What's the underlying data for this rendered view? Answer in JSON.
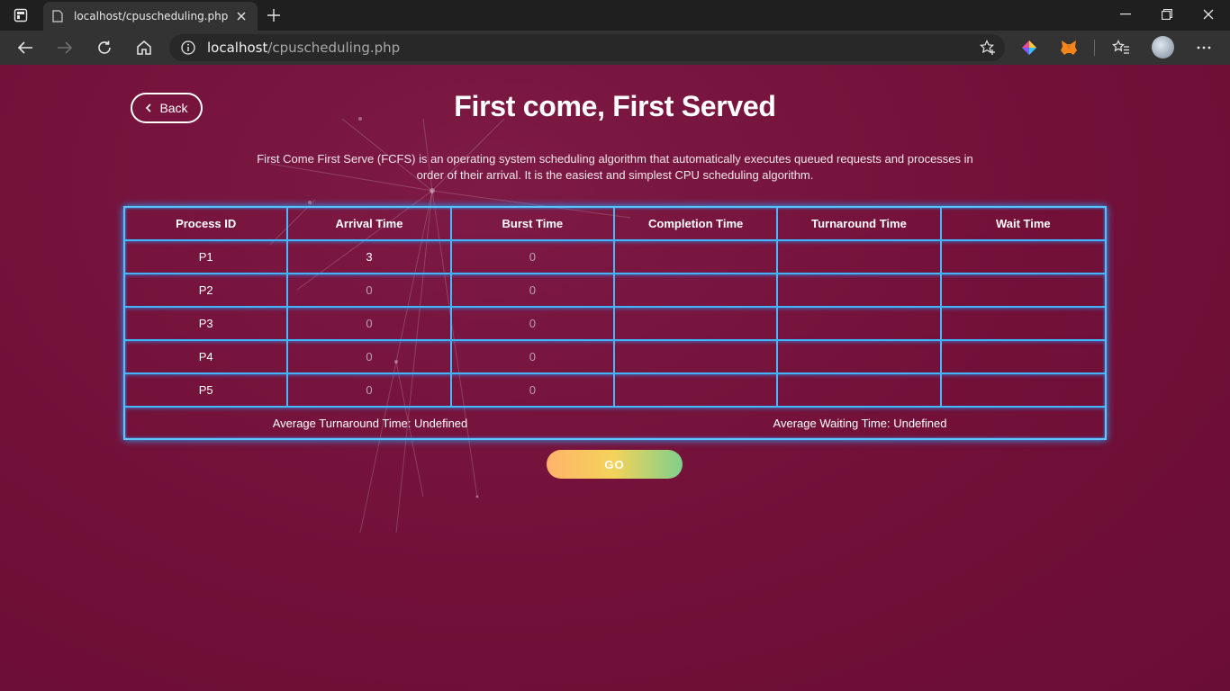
{
  "browser": {
    "tab_title": "localhost/cpuscheduling.php",
    "address_host": "localhost",
    "address_path": "/cpuscheduling.php",
    "icons": [
      "tab-actions-icon",
      "page-favicon-icon",
      "close-tab-icon",
      "new-tab-icon",
      "minimize-icon",
      "restore-icon",
      "close-window-icon",
      "back-arrow-icon",
      "forward-arrow-icon",
      "refresh-icon",
      "home-icon",
      "site-info-icon",
      "add-favorite-icon",
      "extension-icon",
      "metamask-fox-icon",
      "favorites-icon",
      "profile-avatar",
      "more-menu-icon"
    ]
  },
  "page": {
    "back_label": "Back",
    "title": "First come, First Served",
    "description": "First Come First Serve (FCFS) is an operating system scheduling algorithm that automatically executes queued requests and processes in order of their arrival. It is the easiest and simplest CPU scheduling algorithm.",
    "go_label": "GO"
  },
  "table": {
    "headers": [
      "Process ID",
      "Arrival Time",
      "Burst Time",
      "Completion Time",
      "Turnaround Time",
      "Wait Time"
    ],
    "rows": [
      {
        "pid": "P1",
        "arrival_value": "3",
        "arrival_placeholder": "0",
        "burst_value": "",
        "burst_placeholder": "0",
        "completion": "",
        "turnaround": "",
        "wait": ""
      },
      {
        "pid": "P2",
        "arrival_value": "",
        "arrival_placeholder": "0",
        "burst_value": "",
        "burst_placeholder": "0",
        "completion": "",
        "turnaround": "",
        "wait": ""
      },
      {
        "pid": "P3",
        "arrival_value": "",
        "arrival_placeholder": "0",
        "burst_value": "",
        "burst_placeholder": "0",
        "completion": "",
        "turnaround": "",
        "wait": ""
      },
      {
        "pid": "P4",
        "arrival_value": "",
        "arrival_placeholder": "0",
        "burst_value": "",
        "burst_placeholder": "0",
        "completion": "",
        "turnaround": "",
        "wait": ""
      },
      {
        "pid": "P5",
        "arrival_value": "",
        "arrival_placeholder": "0",
        "burst_value": "",
        "burst_placeholder": "0",
        "completion": "",
        "turnaround": "",
        "wait": ""
      }
    ],
    "avg_turnaround": "Average Turnaround Time: Undefined",
    "avg_waiting": "Average Waiting Time: Undefined"
  },
  "colors": {
    "background": "#7a0f3c",
    "neon_border": "#47b8ff",
    "chrome_dark": "#1f1f1f",
    "chrome_toolbar": "#333333"
  }
}
